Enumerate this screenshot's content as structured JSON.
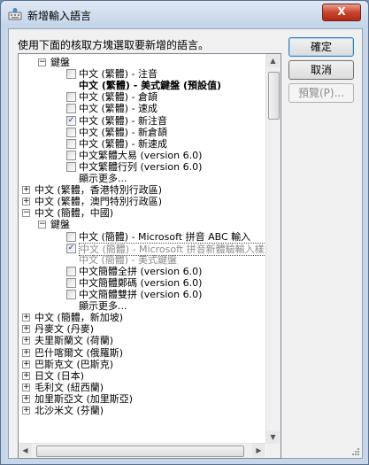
{
  "window": {
    "title": "新增輸入語言",
    "close_label": "X"
  },
  "instruction": "使用下面的核取方塊選取要新增的語言。",
  "tree": {
    "rows": [
      {
        "level": 2,
        "expander": "−",
        "text": "鍵盤"
      },
      {
        "level": 3,
        "checkbox": "",
        "text": "中文 (繁體) - 注音"
      },
      {
        "level": 3,
        "text": "中文 (繁體) - 美式鍵盤 (預設值)",
        "bold": true
      },
      {
        "level": 3,
        "checkbox": "",
        "text": "中文 (繁體) - 倉頡"
      },
      {
        "level": 3,
        "checkbox": "",
        "text": "中文 (繁體) - 速成"
      },
      {
        "level": 3,
        "checkbox": "✓",
        "text": "中文 (繁體) - 新注音"
      },
      {
        "level": 3,
        "checkbox": "",
        "text": "中文 (繁體) - 新倉頡"
      },
      {
        "level": 3,
        "checkbox": "",
        "text": "中文 (繁體) - 新速成"
      },
      {
        "level": 3,
        "checkbox": "",
        "text": "中文繁體大易 (version 6.0)"
      },
      {
        "level": 3,
        "checkbox": "",
        "text": "中文繁體行列 (version 6.0)"
      },
      {
        "level": 3,
        "text": "顯示更多..."
      },
      {
        "level": 1,
        "expander": "+",
        "text": "中文 (繁體，香港特別行政區)"
      },
      {
        "level": 1,
        "expander": "+",
        "text": "中文 (繁體，澳門特別行政區)"
      },
      {
        "level": 1,
        "expander": "−",
        "text": "中文 (簡體，中國)"
      },
      {
        "level": 2,
        "expander": "−",
        "text": "鍵盤"
      },
      {
        "level": 3,
        "checkbox": "",
        "text": "中文 (簡體) - Microsoft 拼音 ABC 輸入"
      },
      {
        "level": 3,
        "checkbox": "✓",
        "text": "中文 (簡體) - Microsoft 拼音新體驗輸入樣式",
        "gray": true,
        "selected": true
      },
      {
        "level": 3,
        "text": "中文 (簡體) - 美式鍵盤",
        "gray": true
      },
      {
        "level": 3,
        "checkbox": "",
        "text": "中文簡體全拼 (version 6.0)"
      },
      {
        "level": 3,
        "checkbox": "",
        "text": "中文簡體鄭碼 (version 6.0)"
      },
      {
        "level": 3,
        "checkbox": "",
        "text": "中文簡體雙拼 (version 6.0)"
      },
      {
        "level": 3,
        "text": "顯示更多..."
      },
      {
        "level": 1,
        "expander": "+",
        "text": "中文 (簡體，新加坡)"
      },
      {
        "level": 1,
        "expander": "+",
        "text": "丹麥文 (丹麥)"
      },
      {
        "level": 1,
        "expander": "+",
        "text": "夫里斯蘭文 (荷蘭)"
      },
      {
        "level": 1,
        "expander": "+",
        "text": "巴什喀爾文 (俄羅斯)"
      },
      {
        "level": 1,
        "expander": "+",
        "text": "巴斯克文 (巴斯克)"
      },
      {
        "level": 1,
        "expander": "+",
        "text": "日文 (日本)"
      },
      {
        "level": 1,
        "expander": "+",
        "text": "毛利文 (紐西蘭)"
      },
      {
        "level": 1,
        "expander": "+",
        "text": "加里斯亞文 (加里斯亞)"
      },
      {
        "level": 1,
        "expander": "+",
        "text": "北沙米文 (芬蘭)"
      }
    ]
  },
  "scroll": {
    "up": "▲",
    "down": "▼",
    "left": "◀",
    "right": "▶"
  },
  "buttons": {
    "ok": "確定",
    "cancel": "取消",
    "preview": "預覽(P)..."
  }
}
